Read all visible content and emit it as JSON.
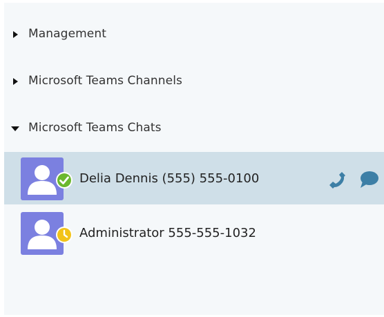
{
  "groups": [
    {
      "label": "Management",
      "expanded": false
    },
    {
      "label": "Microsoft Teams Channels",
      "expanded": false
    },
    {
      "label": "Microsoft Teams Chats",
      "expanded": true
    }
  ],
  "contacts": [
    {
      "name": "Delia Dennis (555) 555-0100",
      "status": "available",
      "selected": true,
      "actions": [
        "phone-icon",
        "chat-icon"
      ]
    },
    {
      "name": "Administrator 555-555-1032",
      "status": "away",
      "selected": false,
      "actions": []
    }
  ],
  "colors": {
    "panel_bg": "#f5f8fa",
    "selected_row": "#cfdfe8",
    "avatar_bg": "#7b80e0",
    "available": "#6bb82e",
    "away": "#f2c31a",
    "action_icon": "#3d7fa6",
    "text": "#333333"
  }
}
